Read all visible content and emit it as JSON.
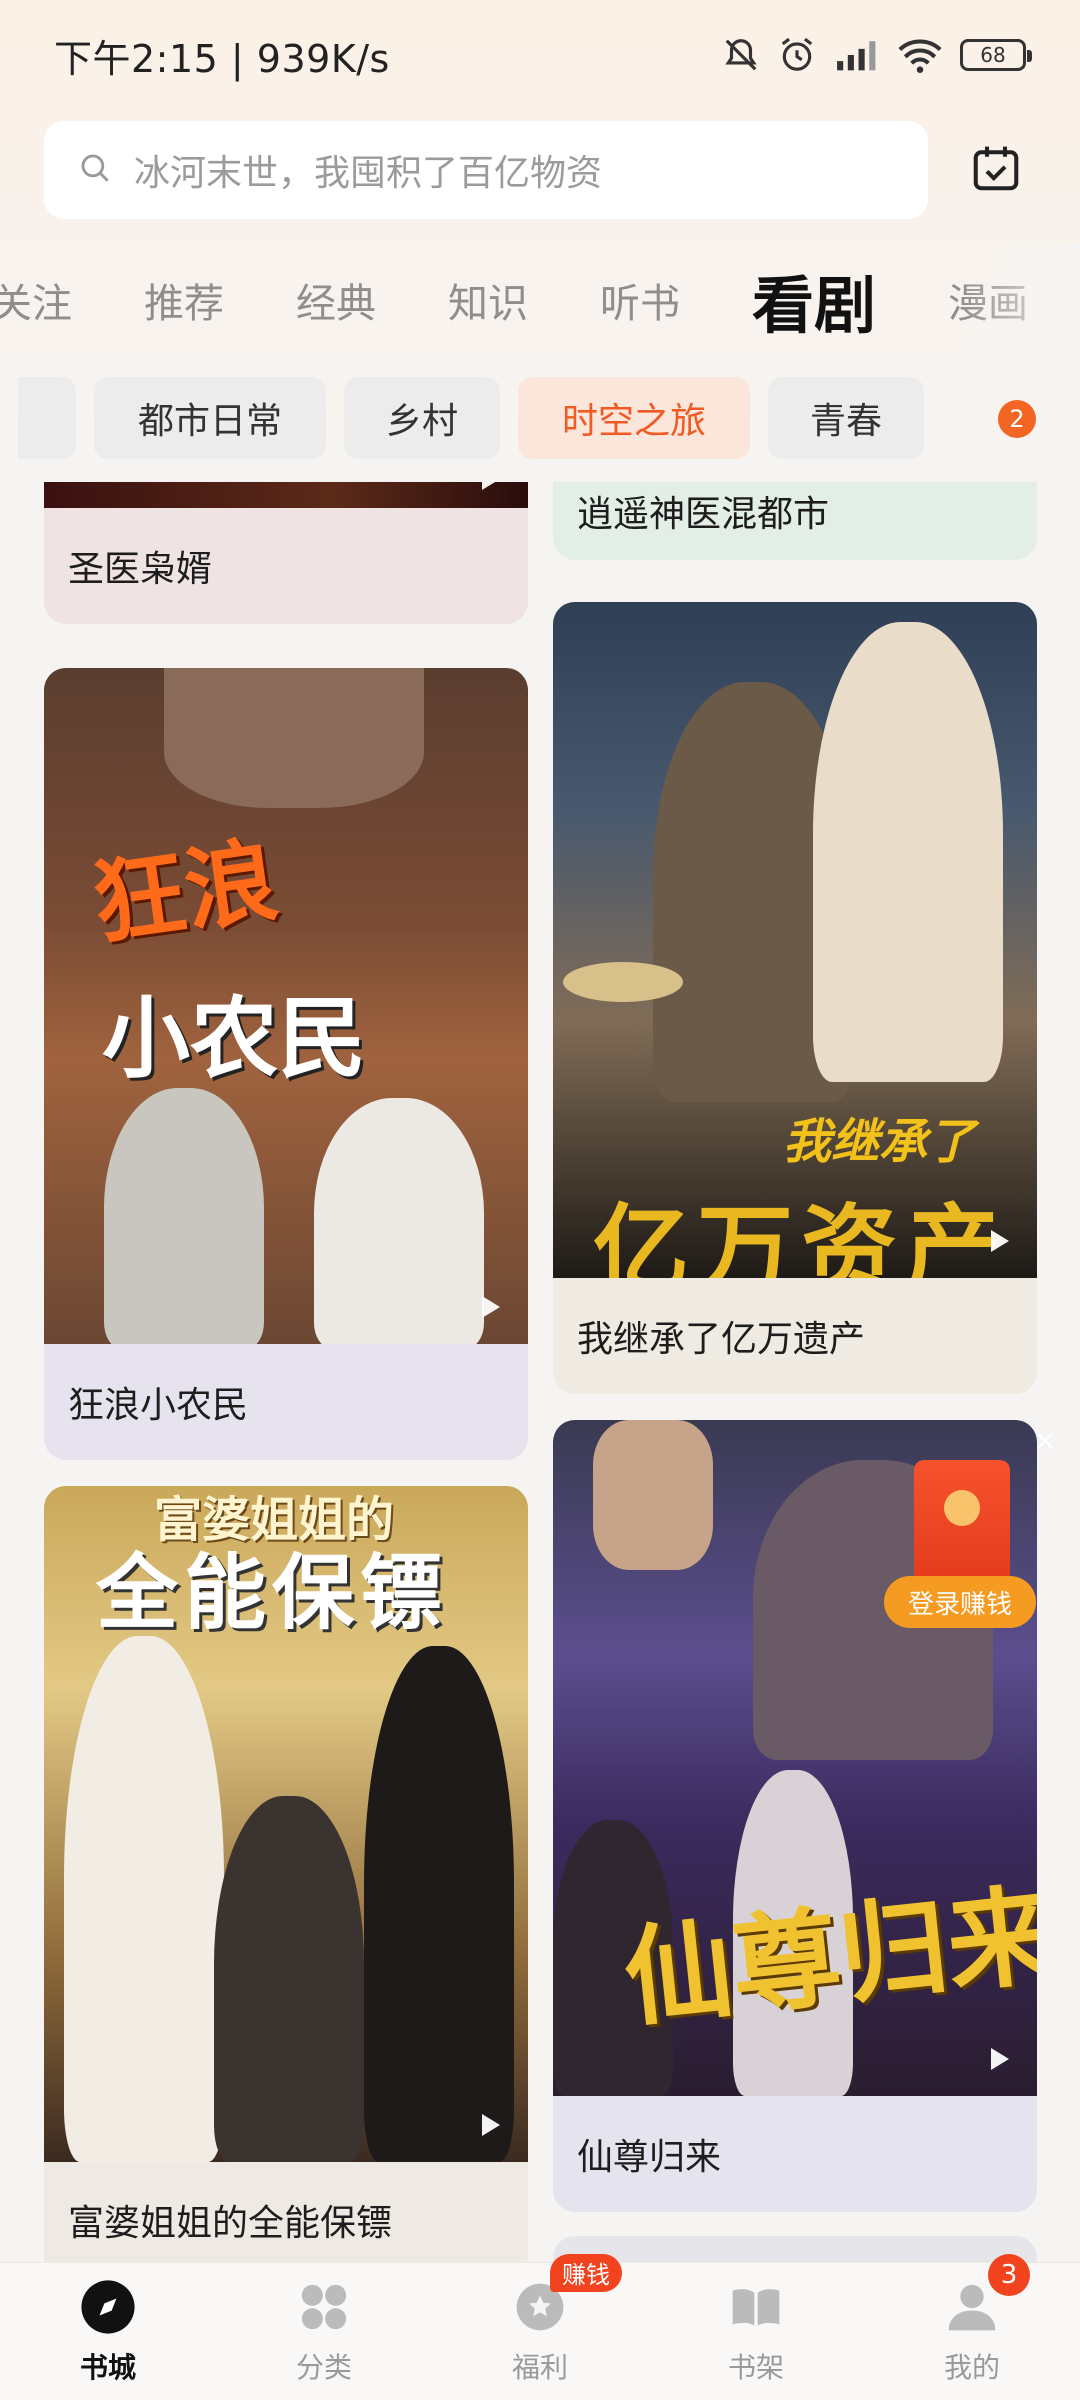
{
  "status_bar": {
    "time_speed": "下午2:15 | 939K/s",
    "battery": "68"
  },
  "search": {
    "placeholder": "冰河末世，我囤积了百亿物资"
  },
  "tabs": [
    {
      "label": "关注"
    },
    {
      "label": "推荐"
    },
    {
      "label": "经典"
    },
    {
      "label": "知识"
    },
    {
      "label": "听书"
    },
    {
      "label": "看剧"
    },
    {
      "label": "漫画"
    }
  ],
  "active_tab": "看剧",
  "categories": [
    {
      "label": "都市日常"
    },
    {
      "label": "乡村"
    },
    {
      "label": "时空之旅"
    },
    {
      "label": "青春"
    }
  ],
  "categories_badge": "2",
  "feed": {
    "cards": [
      {
        "title": "圣医枭婿"
      },
      {
        "title": "逍遥神医混都市"
      },
      {
        "title": "狂浪小农民",
        "poster_text": [
          "狂浪",
          "小农民"
        ]
      },
      {
        "title": "我继承了亿万遗产",
        "poster_text": [
          "我继承了",
          "亿万资产"
        ]
      },
      {
        "title": "富婆姐姐的全能保镖",
        "poster_text": [
          "富婆姐姐的",
          "全能保镖"
        ]
      },
      {
        "title": "仙尊归来",
        "poster_text": [
          "仙尊归来"
        ]
      }
    ]
  },
  "red_packet": {
    "label": "登录赚钱",
    "close": "×"
  },
  "bottom_nav": [
    {
      "label": "书城",
      "icon": "compass-icon"
    },
    {
      "label": "分类",
      "icon": "grid-icon"
    },
    {
      "label": "福利",
      "icon": "gift-icon",
      "badge": "赚钱"
    },
    {
      "label": "书架",
      "icon": "book-icon"
    },
    {
      "label": "我的",
      "icon": "person-icon",
      "badge": "3"
    }
  ],
  "colors": {
    "accent": "#f15a22",
    "badge": "#f2431f"
  }
}
